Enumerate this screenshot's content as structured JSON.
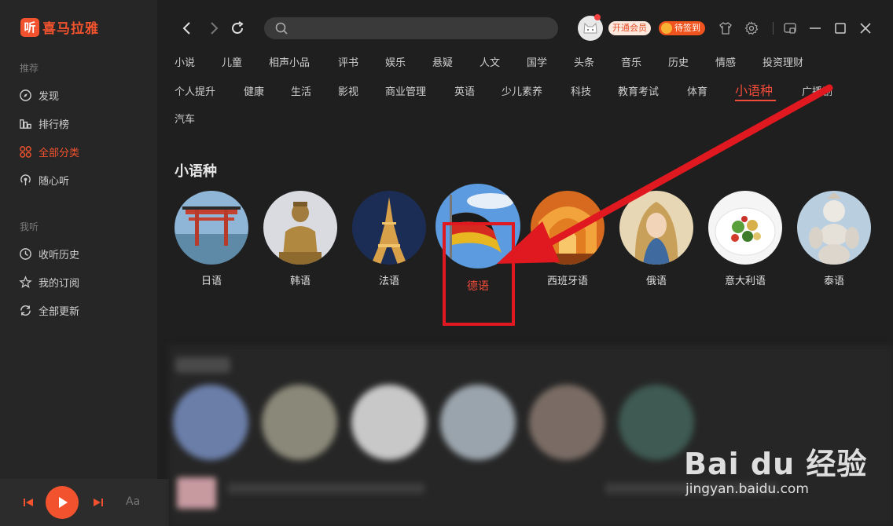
{
  "app": {
    "logo_badge": "听",
    "logo_text": "喜马拉雅"
  },
  "sidebar": {
    "section_recommend": "推荐",
    "section_mine": "我听",
    "items": [
      {
        "label": "发现",
        "icon": "compass-icon"
      },
      {
        "label": "排行榜",
        "icon": "ranking-icon"
      },
      {
        "label": "全部分类",
        "icon": "grid-icon",
        "active": true
      },
      {
        "label": "随心听",
        "icon": "radio-icon"
      },
      {
        "label": "收听历史",
        "icon": "clock-icon"
      },
      {
        "label": "我的订阅",
        "icon": "star-icon"
      },
      {
        "label": "全部更新",
        "icon": "refresh-icon"
      }
    ]
  },
  "player": {
    "font_toggle": "Aa"
  },
  "topbar": {
    "search_placeholder": "",
    "vip_label": "开通会员",
    "checkin_label": "待签到"
  },
  "categories": {
    "row1": [
      "小说",
      "儿童",
      "相声小品",
      "评书",
      "娱乐",
      "悬疑",
      "人文",
      "国学",
      "头条",
      "音乐",
      "历史",
      "情感",
      "投资理财"
    ],
    "row2": [
      "个人提升",
      "健康",
      "生活",
      "影视",
      "商业管理",
      "英语",
      "少儿素养",
      "科技",
      "教育考试",
      "体育",
      "小语种",
      "广播剧"
    ],
    "row3": [
      "汽车"
    ],
    "active": "小语种"
  },
  "section": {
    "title": "小语种",
    "languages": [
      "日语",
      "韩语",
      "法语",
      "德语",
      "西班牙语",
      "俄语",
      "意大利语",
      "泰语"
    ],
    "selected": "德语"
  },
  "watermark": {
    "logo": "Bai du 经验",
    "url": "jingyan.baidu.com"
  },
  "colors": {
    "accent": "#f2522e",
    "highlight": "#e0181f",
    "background": "#1f1f1f"
  }
}
